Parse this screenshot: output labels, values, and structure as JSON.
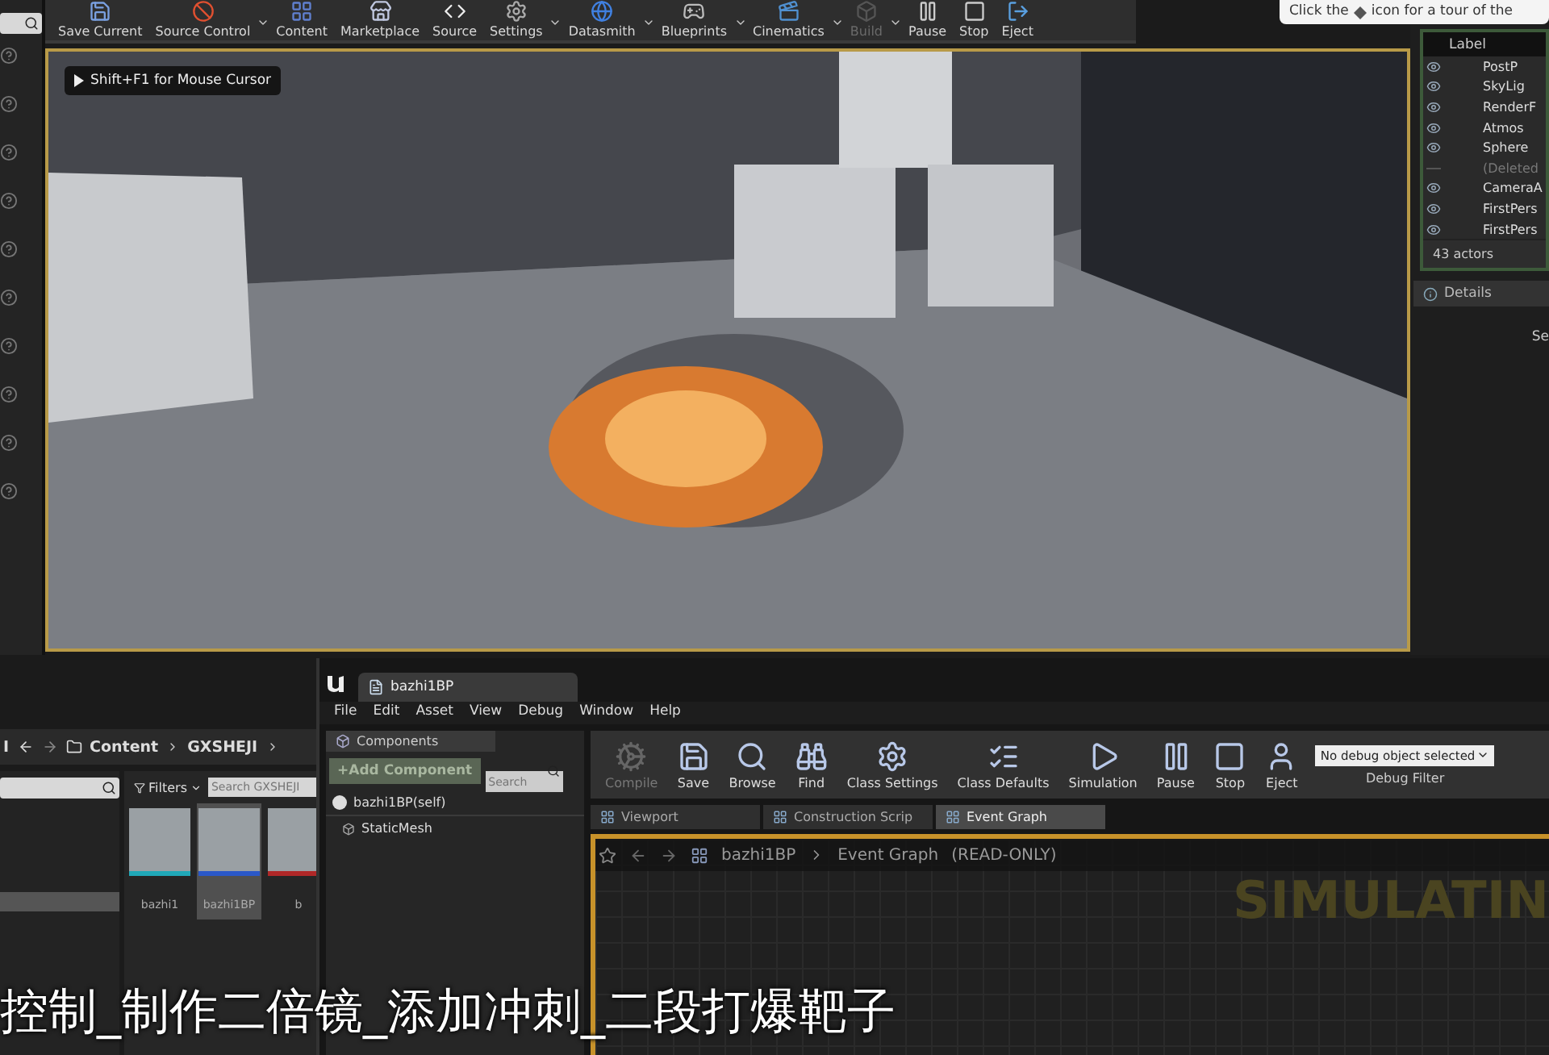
{
  "main_toolbar": [
    {
      "label": "Save Current",
      "dropdown": false,
      "disabled": false
    },
    {
      "label": "Source Control",
      "dropdown": true,
      "disabled": false
    },
    {
      "label": "Content",
      "dropdown": false,
      "disabled": false
    },
    {
      "label": "Marketplace",
      "dropdown": false,
      "disabled": false
    },
    {
      "label": "Source",
      "dropdown": false,
      "disabled": false
    },
    {
      "label": "Settings",
      "dropdown": true,
      "disabled": false
    },
    {
      "label": "Datasmith",
      "dropdown": true,
      "disabled": false
    },
    {
      "label": "Blueprints",
      "dropdown": true,
      "disabled": false
    },
    {
      "label": "Cinematics",
      "dropdown": true,
      "disabled": false
    },
    {
      "label": "Build",
      "dropdown": true,
      "disabled": true
    },
    {
      "label": "Pause",
      "dropdown": false,
      "disabled": false
    },
    {
      "label": "Stop",
      "dropdown": false,
      "disabled": false
    },
    {
      "label": "Eject",
      "dropdown": false,
      "disabled": false
    }
  ],
  "tour_tip": {
    "before": "Click the",
    "after": "icon for a tour of the"
  },
  "viewport": {
    "hint": "Shift+F1 for Mouse Cursor"
  },
  "outliner": {
    "column": "Label",
    "rows": [
      {
        "name": "PostP",
        "visible": true
      },
      {
        "name": "SkyLig",
        "visible": true
      },
      {
        "name": "RenderF",
        "visible": true
      },
      {
        "name": "Atmos",
        "visible": true
      },
      {
        "name": "Sphere",
        "visible": true
      },
      {
        "name": "(Deleted",
        "visible": false
      },
      {
        "name": "CameraA",
        "visible": true
      },
      {
        "name": "FirstPers",
        "visible": true
      },
      {
        "name": "FirstPers",
        "visible": true
      }
    ],
    "count": "43 actors"
  },
  "details": {
    "tab": "Details",
    "text": "Se"
  },
  "content_browser": {
    "cut_label": "I",
    "path": [
      "Content",
      "GXSHEJI"
    ],
    "filters": "Filters",
    "search_placeholder": "Search GXSHEJI",
    "assets": [
      {
        "name": "bazhi1",
        "selected": false,
        "color": "#20a8b8"
      },
      {
        "name": "bazhi1BP",
        "selected": true,
        "color": "#2a58c8"
      },
      {
        "name": "b",
        "selected": false,
        "color": "#b02828"
      }
    ]
  },
  "blueprint_editor": {
    "tab": "bazhi1BP",
    "menu": [
      "File",
      "Edit",
      "Asset",
      "View",
      "Debug",
      "Window",
      "Help"
    ],
    "components": {
      "tab": "Components",
      "add": "+Add Component",
      "search_placeholder": "Search",
      "items": [
        {
          "name": "bazhi1BP(self)",
          "kind": "self"
        },
        {
          "name": "StaticMesh",
          "kind": "mesh"
        }
      ]
    },
    "toolbar": [
      {
        "label": "Compile",
        "disabled": true
      },
      {
        "label": "Save",
        "disabled": false
      },
      {
        "label": "Browse",
        "disabled": false
      },
      {
        "label": "Find",
        "disabled": false
      },
      {
        "label": "Class Settings",
        "disabled": false
      },
      {
        "label": "Class Defaults",
        "disabled": false
      },
      {
        "label": "Simulation",
        "disabled": false
      },
      {
        "label": "Pause",
        "disabled": false
      },
      {
        "label": "Stop",
        "disabled": false
      },
      {
        "label": "Eject",
        "disabled": false
      }
    ],
    "debug_filter": {
      "value": "No debug object selected",
      "label": "Debug Filter"
    },
    "tabs": [
      {
        "label": "Viewport",
        "selected": false
      },
      {
        "label": "Construction Scrip",
        "selected": false
      },
      {
        "label": "Event Graph",
        "selected": true
      }
    ],
    "breadcrumb": {
      "asset": "bazhi1BP",
      "graph": "Event Graph",
      "mode": "(READ-ONLY)"
    },
    "watermark": "SIMULATIN"
  },
  "subtitle": "控制_制作二倍镜_添加冲刺_二段打爆靶子"
}
